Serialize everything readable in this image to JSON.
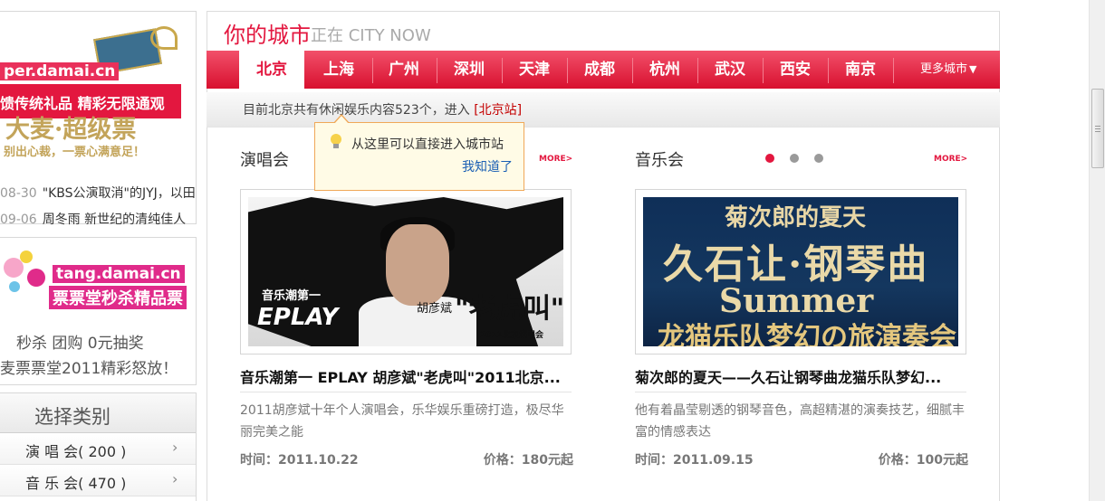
{
  "left": {
    "promo1": {
      "url": "per.damai.cn",
      "gift_text": "馈传统礼品 精彩无限通观",
      "logo": "大麦·超级票",
      "slogan": "别出心裁，一票心满意足！",
      "news": [
        {
          "date": "08-30",
          "text": "\"KBS公演取消\"的JYJ，以田"
        },
        {
          "date": "09-06",
          "text": "周冬雨 新世纪的清纯佳人"
        }
      ]
    },
    "promo2": {
      "url": "tang.damai.cn",
      "title": "票票堂秒杀精品票",
      "line1": "秒杀 团购 0元抽奖",
      "line2": "麦票票堂2011精彩怒放！"
    },
    "categories": {
      "title": "选择类别",
      "items": [
        {
          "label": "演 唱 会( 200 )"
        },
        {
          "label": "音 乐 会( 470 )"
        }
      ]
    }
  },
  "header": {
    "title": "你的城市",
    "subtitle": "正在 CITY NOW"
  },
  "nav": {
    "cities": [
      "北京",
      "上海",
      "广州",
      "深圳",
      "天津",
      "成都",
      "杭州",
      "武汉",
      "西安",
      "南京"
    ],
    "active_index": 0,
    "more": "更多城市"
  },
  "info": {
    "text": "目前北京共有休闲娱乐内容523个，进入",
    "link": "[北京站]"
  },
  "tooltip": {
    "text": "从这里可以直接进入城市站",
    "ok": "我知道了"
  },
  "sections": [
    {
      "title": "演唱会",
      "more": "MORE>",
      "item": {
        "poster_text": {
          "t1": "音乐潮第一",
          "t2": "EPLAY",
          "t3": "\"老虎叫\"",
          "t4": "胡彦斌",
          "t5": "2011北京演唱会"
        },
        "title": "音乐潮第一 EPLAY 胡彦斌\"老虎叫\"2011北京...",
        "desc": "2011胡彦斌十年个人演唱会，乐华娱乐重磅打造，极尽华丽完美之能",
        "time": "时间：2011.10.22",
        "price": "价格：180元起"
      }
    },
    {
      "title": "音乐会",
      "more": "MORE>",
      "item": {
        "poster_text": {
          "l1": "菊次郎的夏天",
          "l2": "久石让·钢琴曲",
          "l3": "Summer",
          "l4": "龙猫乐队梦幻の旅演奏会"
        },
        "title": "菊次郎的夏天——久石让钢琴曲龙猫乐队梦幻...",
        "desc": "他有着晶莹剔透的钢琴音色，高超精湛的演奏技艺，细腻丰富的情感表达",
        "time": "时间：2011.09.15",
        "price": "价格：100元起"
      }
    }
  ],
  "colors": {
    "accent": "#e3173f",
    "link": "#1a5fb4"
  },
  "icons": [
    "lightbulb-icon",
    "chevron-down-icon",
    "chevron-right-icon"
  ]
}
